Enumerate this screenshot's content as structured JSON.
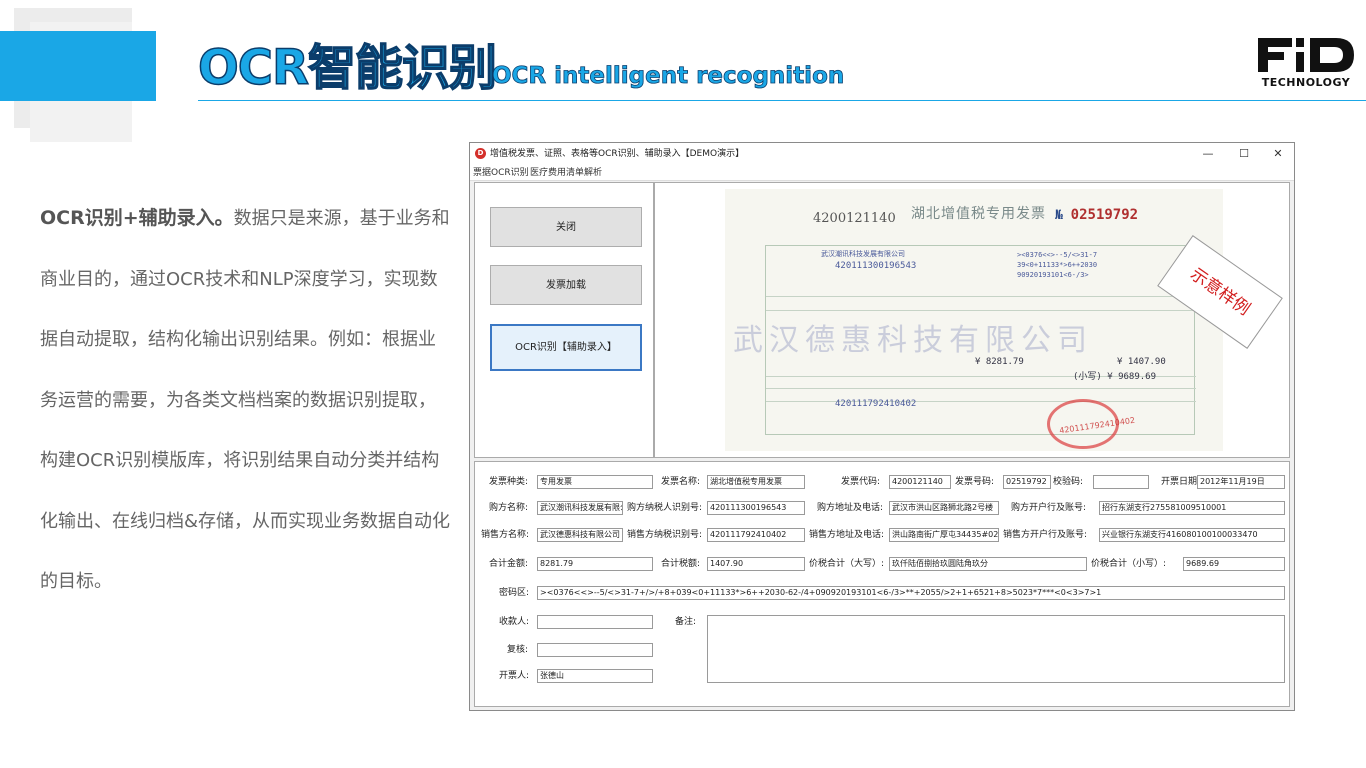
{
  "slide": {
    "title_cn": "OCR智能识别",
    "title_en": "OCR intelligent recognition",
    "logo_letters": "FD",
    "logo_sub": "TECHNOLOGY",
    "body_lead": "OCR识别+辅助录入。",
    "body_rest": "数据只是来源，基于业务和商业目的，通过OCR技术和NLP深度学习，实现数据自动提取，结构化输出识别结果。例如：根据业务运营的需要，为各类文档档案的数据识别提取，构建OCR识别模版库，将识别结果自动分类并结构化输出、在线归档&存储，从而实现业务数据自动化的目标。"
  },
  "window": {
    "icon_letter": "D",
    "title": "增值税发票、证照、表格等OCR识别、辅助录入【DEMO演示】",
    "minimize": "—",
    "maximize": "☐",
    "close": "✕",
    "menu": [
      "票据OCR识别",
      "医疗费用清单解析"
    ]
  },
  "buttons": {
    "close": "关闭",
    "load": "发票加载",
    "ocr": "OCR识别【辅助录入】"
  },
  "invoice_image": {
    "code": "4200121140",
    "heading": "湖北增值税专用发票",
    "no_prefix": "№",
    "no": "02519792",
    "watermark": "武汉德惠科技有限公司",
    "line1": "武汉潮讯科技发展有限公司",
    "line2": "420111300196543",
    "cipher1": "><0376<<>--5/<>31-7",
    "cipher2": "39<0+11133*>6++2030",
    "cipher3": "90920193101<6-/3>",
    "total_small": "¥ 8281.79",
    "total_tax": "¥ 1407.90",
    "total_all": "(小写) ¥ 9689.69",
    "seller_id": "420111792410402",
    "seal_text": "420111792410402",
    "sample_label": "示意样例"
  },
  "form": {
    "invoice_type": {
      "label": "发票种类:",
      "value": "专用发票"
    },
    "invoice_name": {
      "label": "发票名称:",
      "value": "湖北增值税专用发票"
    },
    "invoice_code": {
      "label": "发票代码:",
      "value": "4200121140"
    },
    "invoice_no": {
      "label": "发票号码:",
      "value": "02519792"
    },
    "check_code": {
      "label": "校验码:",
      "value": ""
    },
    "issue_date": {
      "label": "开票日期:",
      "value": "2012年11月19日"
    },
    "buyer_name": {
      "label": "购方名称:",
      "value": "武汉潮讯科技发展有限公司"
    },
    "buyer_taxid": {
      "label": "购方纳税人识别号:",
      "value": "420111300196543"
    },
    "buyer_addr": {
      "label": "购方地址及电话:",
      "value": "武汉市洪山区路狮北路2号楼"
    },
    "buyer_bank": {
      "label": "购方开户行及账号:",
      "value": "招行东湖支行275581009510001"
    },
    "seller_name": {
      "label": "销售方名称:",
      "value": "武汉德惠科技有限公司"
    },
    "seller_taxid": {
      "label": "销售方纳税识别号:",
      "value": "420111792410402"
    },
    "seller_addr": {
      "label": "销售方地址及电话:",
      "value": "洪山路南街广厚屯34435#027"
    },
    "seller_bank": {
      "label": "销售方开户行及账号:",
      "value": "兴业银行东湖支行416080100100033470"
    },
    "amount": {
      "label": "合计金额:",
      "value": "8281.79"
    },
    "tax": {
      "label": "合计税额:",
      "value": "1407.90"
    },
    "total_upper": {
      "label": "价税合计（大写）:",
      "value": "玖仟陆佰捌拾玖圆陆角玖分"
    },
    "total_lower": {
      "label": "价税合计（小写）:",
      "value": "9689.69"
    },
    "cipher": {
      "label": "密码区:",
      "value": "><0376<<>--5/<>31-7+/>/+8+039<0+11133*>6++2030-62-/4+090920193101<6-/3>**+2055/>2+1+6521+8>5023*7***<0<3>7>1"
    },
    "payee": {
      "label": "收款人:",
      "value": ""
    },
    "remark": {
      "label": "备注:",
      "value": ""
    },
    "reviewer": {
      "label": "复核:",
      "value": ""
    },
    "drawer": {
      "label": "开票人:",
      "value": "张德山"
    }
  }
}
